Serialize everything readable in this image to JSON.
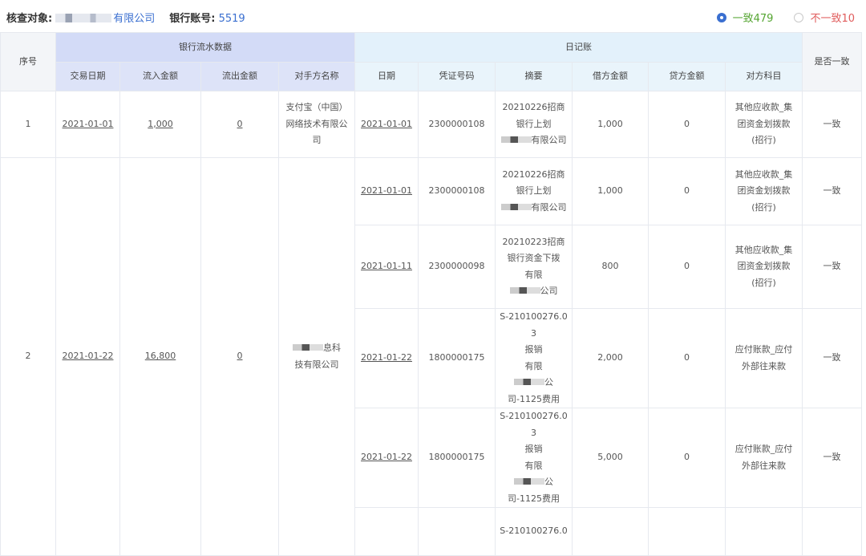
{
  "header": {
    "target_label": "核查对象:",
    "target_value": "有限公司",
    "account_label": "银行账号:",
    "account_value": "5519",
    "filter_consistent": "一致479",
    "filter_inconsistent": "不一致10",
    "colors": {
      "accent": "#3a6fd0",
      "consistent": "#55a532",
      "inconsistent": "#e05c5c"
    }
  },
  "table": {
    "headers": {
      "seq": "序号",
      "bank_group": "银行流水数据",
      "diary_group": "日记账",
      "match": "是否一致",
      "bank_cols": [
        "交易日期",
        "流入金额",
        "流出金额",
        "对手方名称"
      ],
      "diary_cols": [
        "日期",
        "凭证号码",
        "摘要",
        "借方金额",
        "贷方金额",
        "对方科目"
      ]
    },
    "groups": [
      {
        "seq": "1",
        "bank": {
          "date": "2021-01-01",
          "in": "1,000",
          "out": "0",
          "counterparty": [
            "支付宝（中国）",
            "网络技术有限公",
            "司"
          ]
        },
        "entries": [
          {
            "date": "2021-01-01",
            "voucher": "2300000108",
            "summary": [
              "20210226招商",
              "银行上划",
              "有限公司"
            ],
            "debit": "1,000",
            "credit": "0",
            "account": [
              "其他应收款_集",
              "团资金划拨款",
              "(招行)"
            ],
            "match": "一致"
          }
        ]
      },
      {
        "seq": "2",
        "bank": {
          "date": "2021-01-22",
          "in": "16,800",
          "out": "0",
          "counterparty": [
            "息科",
            "技有限公司"
          ]
        },
        "entries": [
          {
            "date": "2021-01-01",
            "voucher": "2300000108",
            "summary": [
              "20210226招商",
              "银行上划",
              "有限公司"
            ],
            "debit": "1,000",
            "credit": "0",
            "account": [
              "其他应收款_集",
              "团资金划拨款",
              "(招行)"
            ],
            "match": "一致"
          },
          {
            "date": "2021-01-11",
            "voucher": "2300000098",
            "summary": [
              "20210223招商",
              "银行资金下拨",
              "有限",
              "公司"
            ],
            "debit": "800",
            "credit": "0",
            "account": [
              "其他应收款_集",
              "团资金划拨款",
              "(招行)"
            ],
            "match": "一致"
          },
          {
            "date": "2021-01-22",
            "voucher": "1800000175",
            "summary": [
              "S-210100276.0",
              "3",
              "报销",
              "有限",
              "公司-1125费用"
            ],
            "debit": "2,000",
            "credit": "0",
            "account": [
              "应付账款_应付",
              "外部往来款"
            ],
            "match": "一致"
          },
          {
            "date": "2021-01-22",
            "voucher": "1800000175",
            "summary": [
              "S-210100276.0",
              "3",
              "报销",
              "有限",
              "公司-1125费用"
            ],
            "debit": "5,000",
            "credit": "0",
            "account": [
              "应付账款_应付",
              "外部往来款"
            ],
            "match": "一致"
          },
          {
            "date": "",
            "voucher": "",
            "summary": [
              "S-210100276.0"
            ],
            "debit": "",
            "credit": "",
            "account": [],
            "match": ""
          }
        ]
      }
    ]
  }
}
